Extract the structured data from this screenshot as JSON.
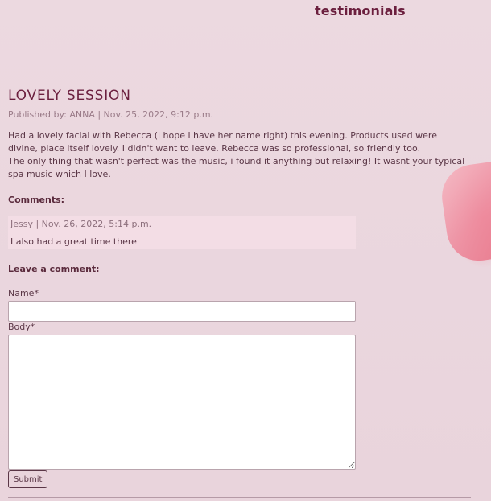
{
  "header": {
    "title": "testimonials"
  },
  "post": {
    "title": "LOVELY SESSION",
    "meta": "Published by: ANNA | Nov. 25, 2022, 9:12 p.m.",
    "paragraphs": [
      "Had a lovely facial with Rebecca (i hope i have her name right) this evening. Products used were divine, place itself lovely. I didn't want to leave. Rebecca was so professional, so friendly too.",
      "The only thing that wasn't perfect was the music, i found it anything but relaxing! It wasnt your typical spa music which I love."
    ]
  },
  "comments": {
    "label": "Comments:",
    "items": [
      {
        "meta": "Jessy | Nov. 26, 2022, 5:14 p.m.",
        "text": "I also had a great time there"
      }
    ]
  },
  "form": {
    "label": "Leave a comment:",
    "name_label": "Name*",
    "name_value": "",
    "body_label": "Body*",
    "body_value": "",
    "submit_label": "Submit"
  },
  "colors": {
    "background": "#ead7df",
    "accent": "#6b1f3e",
    "comment_bg": "#f3dde5"
  }
}
